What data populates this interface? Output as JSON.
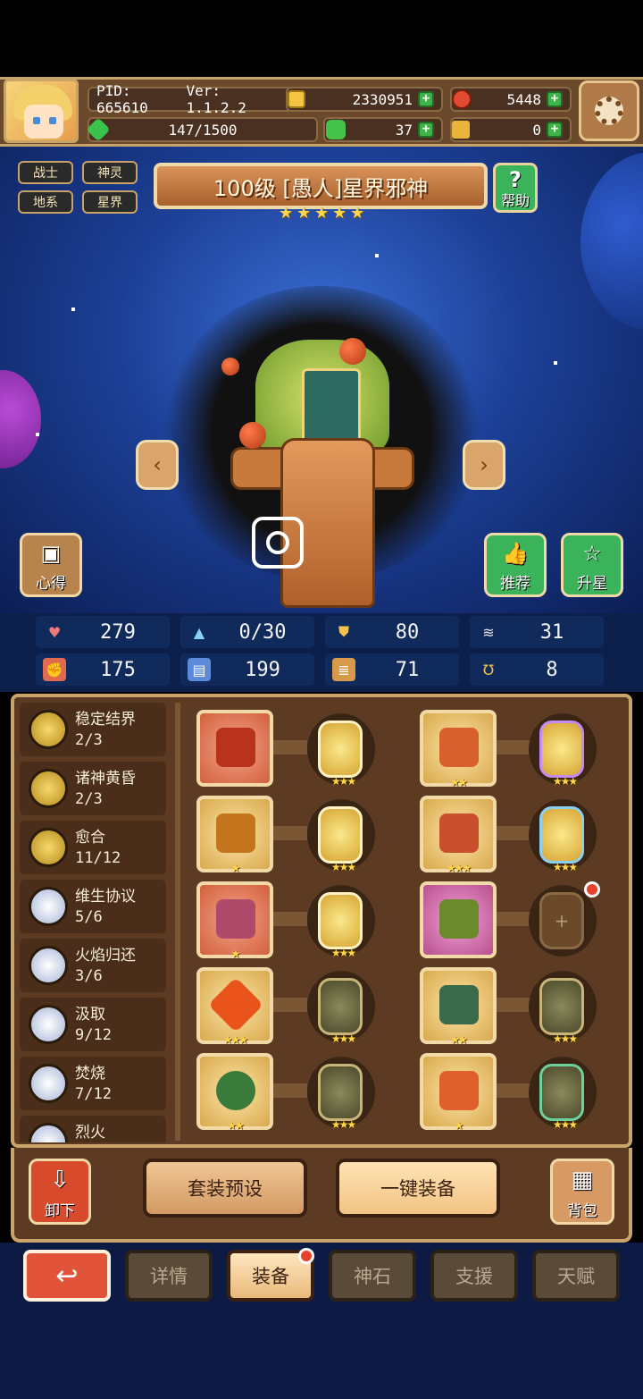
{
  "header": {
    "pid": "PID: 665610",
    "version": "Ver: 1.1.2.2",
    "gold": "2330951",
    "ruby": "5448",
    "exp": "147/1500",
    "clover": "37",
    "keys": "0"
  },
  "tags": [
    "战士",
    "神灵",
    "地系",
    "星界"
  ],
  "hero": {
    "title": "100级 [愚人]星界邪神",
    "stars": 5,
    "help_label": "帮助"
  },
  "side_buttons": {
    "notes": "心得",
    "recommend": "推荐",
    "upgrade_star": "升星"
  },
  "stats": [
    {
      "icon": "heart-icon",
      "value": "279"
    },
    {
      "icon": "water-drop-icon",
      "value": "0/30"
    },
    {
      "icon": "shield-icon",
      "value": "80"
    },
    {
      "icon": "wing-icon",
      "value": "31"
    },
    {
      "icon": "fist-icon",
      "value": "175"
    },
    {
      "icon": "book-icon",
      "value": "199"
    },
    {
      "icon": "scroll-icon",
      "value": "71"
    },
    {
      "icon": "horseshoe-icon",
      "value": "8"
    }
  ],
  "sets": [
    {
      "name": "稳定结界",
      "progress": "2/3",
      "badge": "gold"
    },
    {
      "name": "诸神黄昏",
      "progress": "2/3",
      "badge": "gold"
    },
    {
      "name": "愈合",
      "progress": "11/12",
      "badge": "gold"
    },
    {
      "name": "维生协议",
      "progress": "5/6",
      "badge": "silver"
    },
    {
      "name": "火焰归还",
      "progress": "3/6",
      "badge": "silver"
    },
    {
      "name": "汲取",
      "progress": "9/12",
      "badge": "silver"
    },
    {
      "name": "焚烧",
      "progress": "7/12",
      "badge": "silver"
    },
    {
      "name": "烈火",
      "progress": "",
      "badge": "silver"
    }
  ],
  "actions": {
    "unequip": "卸下",
    "preset": "套装预设",
    "one_click": "一键装备",
    "bag": "背包"
  },
  "tabs": [
    "详情",
    "装备",
    "神石",
    "支援",
    "天赋"
  ],
  "active_tab": "装备",
  "colors": {
    "panel_brown": "#5c3b22",
    "border_gold": "#c9a46a",
    "accent_green": "#3bb35a",
    "accent_red": "#e2543a"
  }
}
